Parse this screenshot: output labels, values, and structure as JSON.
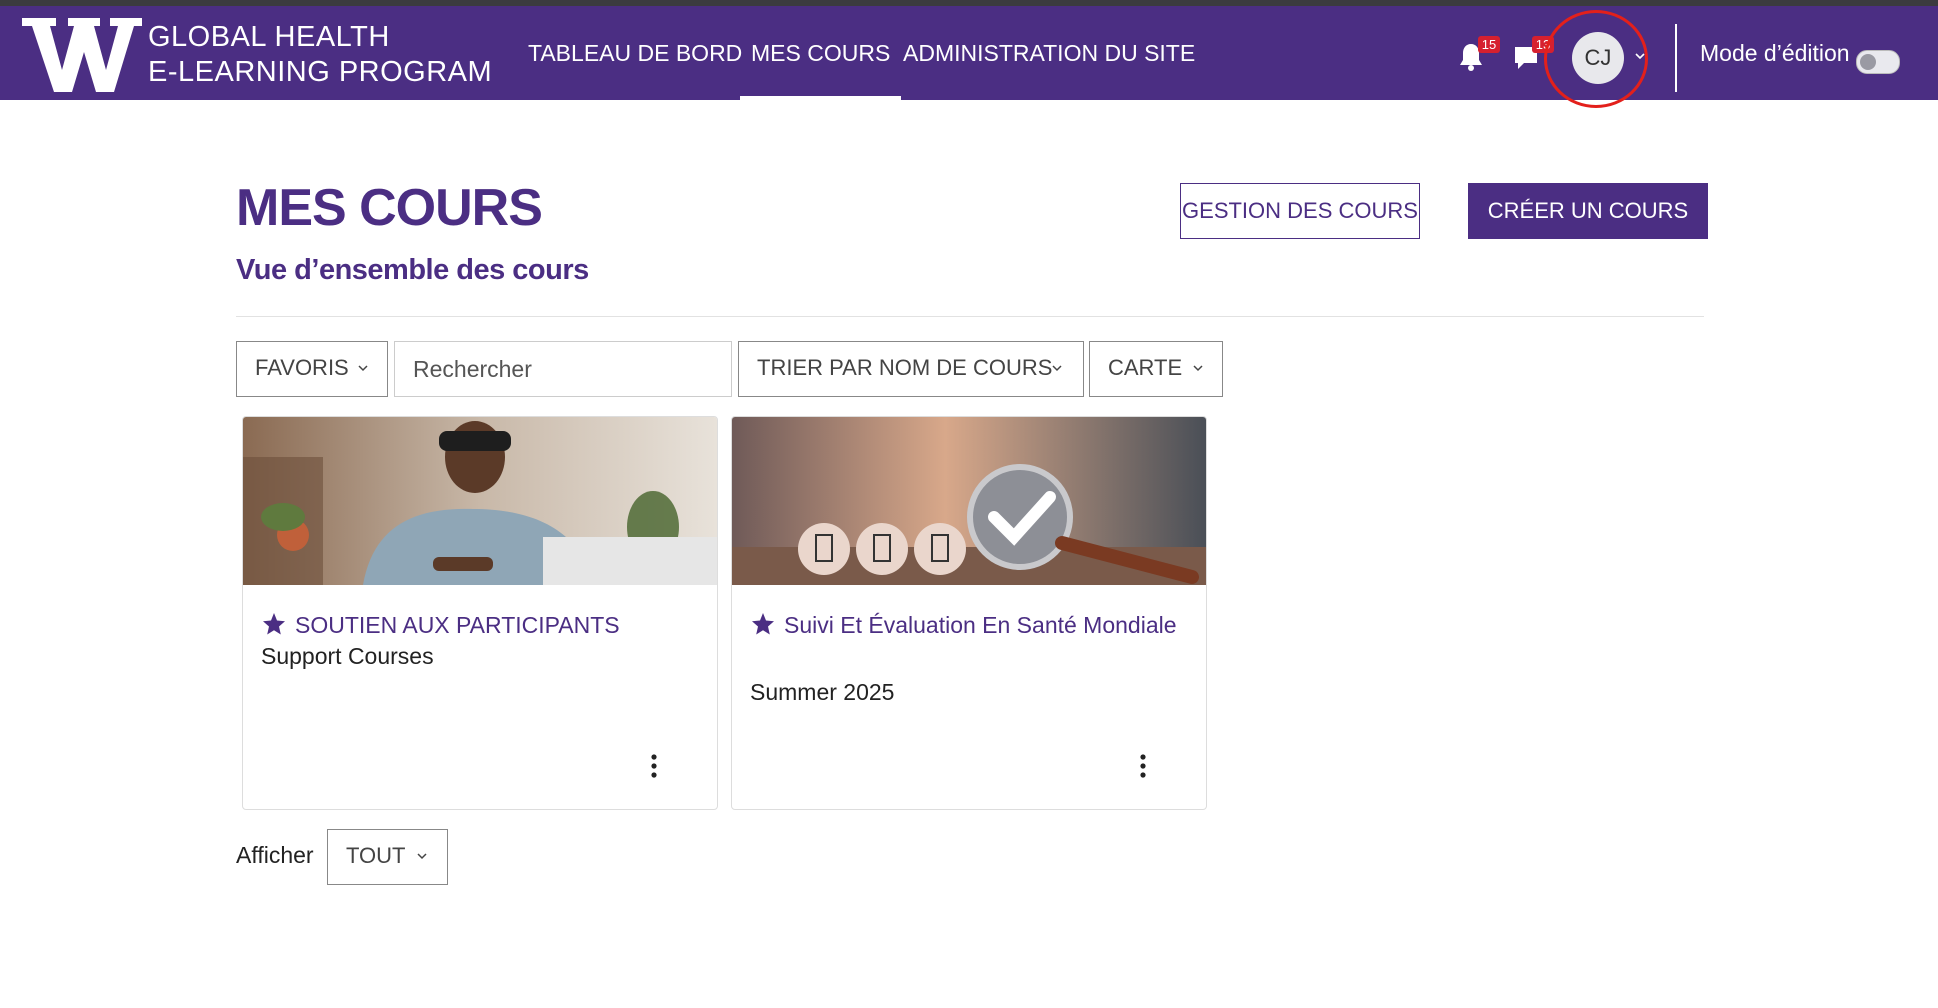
{
  "header": {
    "logo_line1": "GLOBAL HEALTH",
    "logo_line2": "E-LEARNING PROGRAM",
    "nav": [
      {
        "label": "TABLEAU DE BORD"
      },
      {
        "label": "MES COURS"
      },
      {
        "label": "ADMINISTRATION DU SITE"
      }
    ],
    "notifications_count": "15",
    "messages_count": "13",
    "user_initials": "CJ",
    "edit_mode_label": "Mode d’édition"
  },
  "page": {
    "title": "MES COURS",
    "subtitle": "Vue d’ensemble des cours",
    "manage_button": "GESTION DES COURS",
    "create_button": "CRÉER UN COURS"
  },
  "filters": {
    "grouping": "FAVORIS",
    "search_placeholder": "Rechercher",
    "sort": "TRIER PAR NOM DE COURS",
    "view": "CARTE"
  },
  "courses": [
    {
      "title": "SOUTIEN AUX PARTICIPANTS",
      "category": "Support Courses"
    },
    {
      "title": "Suivi Et Évaluation En Santé Mondiale",
      "category": "Summer 2025"
    }
  ],
  "pagination": {
    "show_label": "Afficher",
    "show_value": "TOUT"
  },
  "colors": {
    "brand": "#4b2e83",
    "badge": "#d6202f",
    "highlight_ring": "#e3201b"
  }
}
